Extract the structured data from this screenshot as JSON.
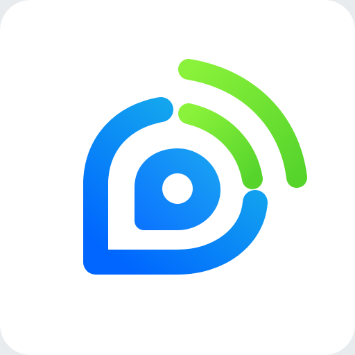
{
  "icon": {
    "name": "location-signal-logo-icon",
    "colors": {
      "tile_background": "#ffffff",
      "pin_gradient_start": "#0066ff",
      "pin_gradient_end": "#18b6ea",
      "signal_gradient_start": "#5ad62e",
      "signal_gradient_end": "#8ff33d"
    }
  }
}
